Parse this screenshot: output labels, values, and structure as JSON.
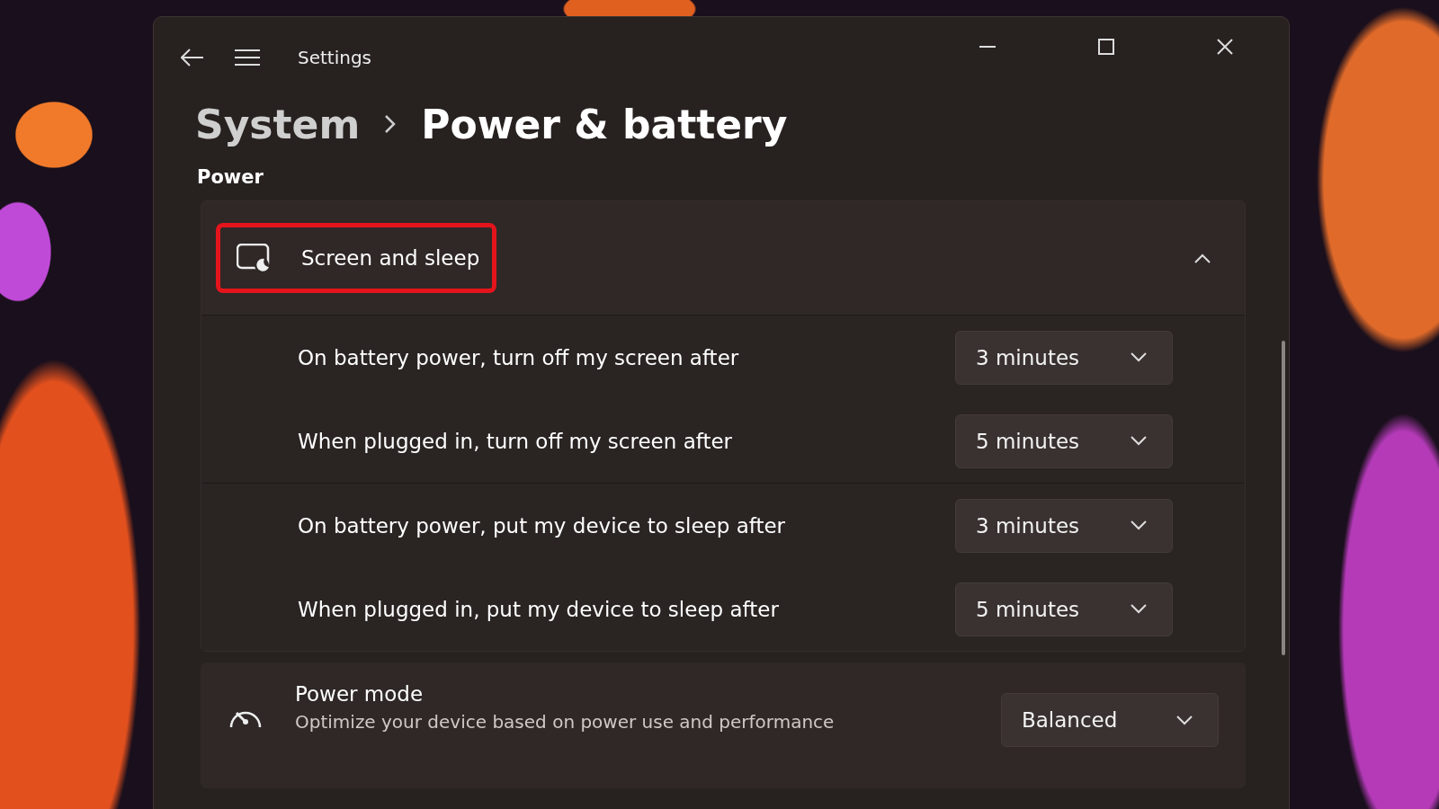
{
  "window": {
    "title": "Settings"
  },
  "breadcrumb": [
    {
      "label": "System",
      "current": false
    },
    {
      "label": "Power & battery",
      "current": true
    }
  ],
  "section": {
    "heading": "Power"
  },
  "screen_and_sleep": {
    "title": "Screen and sleep",
    "expanded": true,
    "highlighted": true,
    "groups": [
      {
        "rows": [
          {
            "label": "On battery power, turn off my screen after",
            "value": "3 minutes"
          },
          {
            "label": "When plugged in, turn off my screen after",
            "value": "5 minutes"
          }
        ]
      },
      {
        "rows": [
          {
            "label": "On battery power, put my device to sleep after",
            "value": "3 minutes"
          },
          {
            "label": "When plugged in, put my device to sleep after",
            "value": "5 minutes"
          }
        ]
      }
    ]
  },
  "power_mode": {
    "title": "Power mode",
    "description": "Optimize your device based on power use and performance",
    "value": "Balanced"
  }
}
